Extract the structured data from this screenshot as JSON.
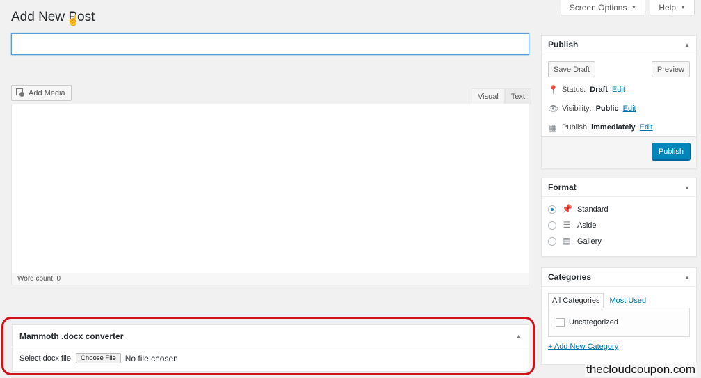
{
  "header": {
    "title": "Add New Post",
    "screen_options": "Screen Options",
    "help": "Help"
  },
  "post": {
    "title_value": "",
    "add_media": "Add Media",
    "tab_visual": "Visual",
    "tab_text": "Text",
    "word_count": "Word count: 0"
  },
  "mammoth": {
    "title": "Mammoth .docx converter",
    "select_label": "Select docx file:",
    "choose_file": "Choose File",
    "no_file": "No file chosen"
  },
  "publish": {
    "title": "Publish",
    "save_draft": "Save Draft",
    "preview": "Preview",
    "status_label": "Status:",
    "status_value": "Draft",
    "visibility_label": "Visibility:",
    "visibility_value": "Public",
    "schedule_label": "Publish",
    "schedule_value": "immediately",
    "edit": "Edit",
    "publish_button": "Publish"
  },
  "format": {
    "title": "Format",
    "options": [
      {
        "label": "Standard",
        "checked": true
      },
      {
        "label": "Aside",
        "checked": false
      },
      {
        "label": "Gallery",
        "checked": false
      }
    ]
  },
  "categories": {
    "title": "Categories",
    "tab_all": "All Categories",
    "tab_most_used": "Most Used",
    "items": [
      {
        "label": "Uncategorized",
        "checked": false
      }
    ],
    "add_new": "+ Add New Category"
  },
  "watermark": "thecloudcoupon.com",
  "colors": {
    "primary": "#0085ba",
    "link": "#0073aa",
    "highlight": "#d0121b"
  }
}
